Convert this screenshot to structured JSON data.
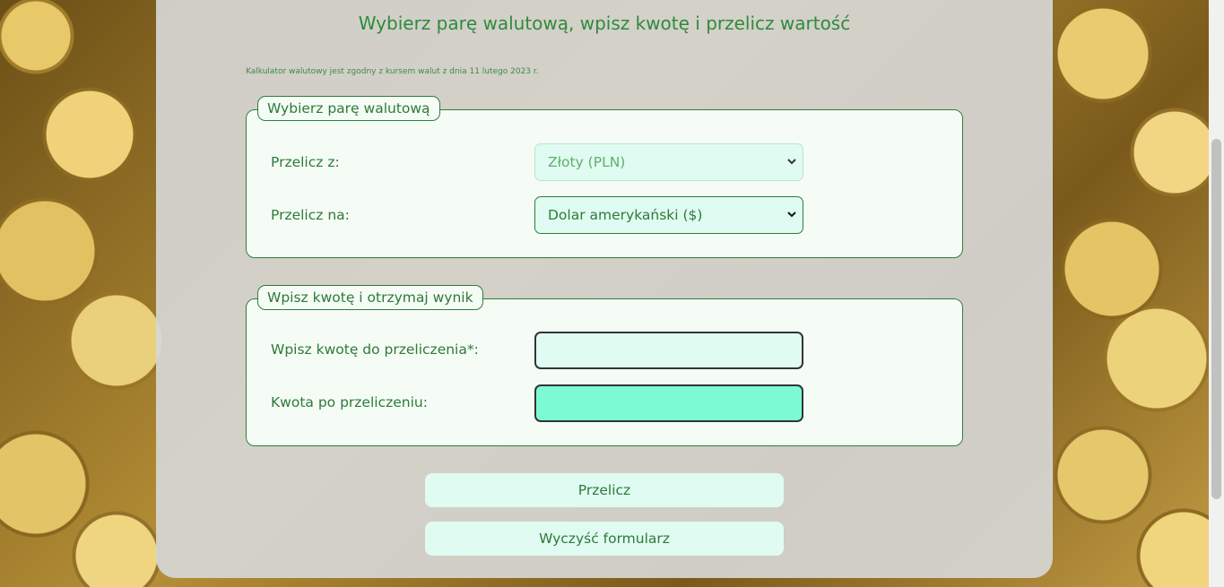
{
  "header": {
    "title": "Wybierz parę walutową, wpisz kwotę i przelicz wartość",
    "note": "Kalkulator walutowy jest zgodny z kursem walut z dnia 11 lutego 2023 r."
  },
  "currency_pair": {
    "legend": "Wybierz parę walutową",
    "from_label": "Przelicz z:",
    "from_value": "Złoty (PLN)",
    "to_label": "Przelicz na:",
    "to_value": "Dolar amerykański ($)"
  },
  "amount": {
    "legend": "Wpisz kwotę i otrzymaj wynik",
    "input_label": "Wpisz kwotę do przeliczenia*:",
    "input_value": "",
    "result_label": "Kwota po przeliczeniu:",
    "result_value": ""
  },
  "buttons": {
    "convert": "Przelicz",
    "clear": "Wyczyść formularz"
  },
  "colors": {
    "accent": "#2e7a39",
    "field_bg": "#e0fbf1",
    "result_bg": "#7cfad4"
  }
}
